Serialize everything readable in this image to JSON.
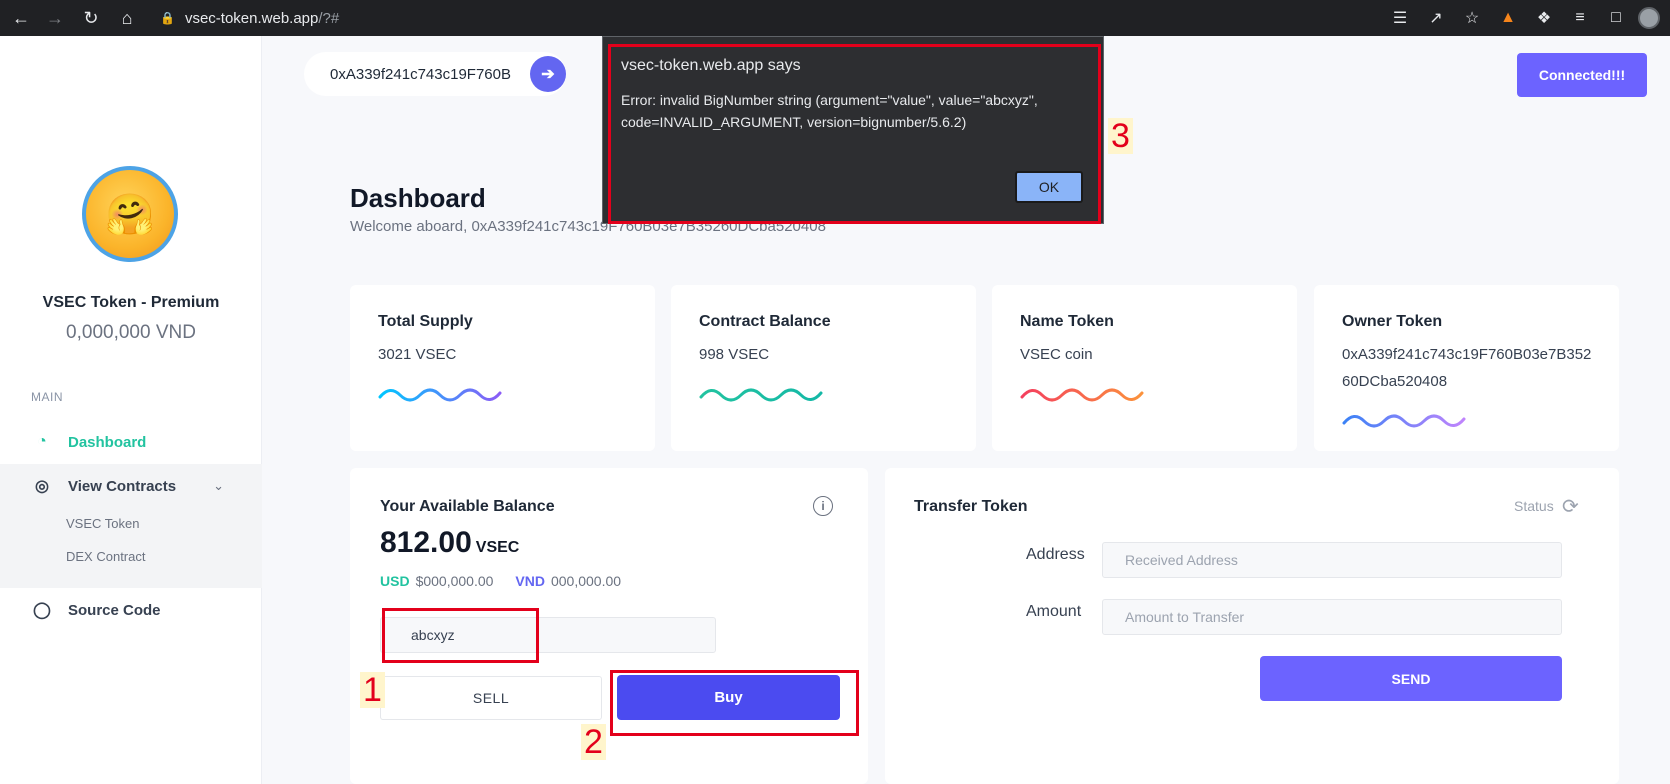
{
  "browser": {
    "url_host": "vsec-token.web.app",
    "url_path": "/?#"
  },
  "sidebar": {
    "name": "VSEC Token - Premium",
    "balance": "0,000,000 VND",
    "section": "MAIN",
    "items": [
      {
        "label": "Dashboard"
      },
      {
        "label": "View Contracts"
      },
      {
        "label": "Source Code"
      }
    ],
    "subitems": [
      {
        "label": "VSEC Token"
      },
      {
        "label": "DEX Contract"
      }
    ]
  },
  "header": {
    "address_value": "0xA339f241c743c19F760B",
    "connect_label": "Connected!!!"
  },
  "dashboard": {
    "title": "Dashboard",
    "welcome": "Welcome aboard, 0xA339f241c743c19F760B03e7B35260DCba520408"
  },
  "stats": [
    {
      "label": "Total Supply",
      "value": "3021 VSEC",
      "color1": "#00c6ff",
      "color2": "#8b5cf6"
    },
    {
      "label": "Contract Balance",
      "value": "998 VSEC",
      "color1": "#22c3a0",
      "color2": "#14b8a6"
    },
    {
      "label": "Name Token",
      "value": "VSEC coin",
      "color1": "#f43f5e",
      "color2": "#fb923c"
    },
    {
      "label": "Owner Token",
      "value": "0xA339f241c743c19F760B03e7B35260DCba520408",
      "color1": "#3b82f6",
      "color2": "#c084fc"
    }
  ],
  "balance_panel": {
    "title": "Your Available Balance",
    "amount": "812.00",
    "unit": "VSEC",
    "usd_label": "USD",
    "usd_value": "$000,000.00",
    "vnd_label": "VND",
    "vnd_value": "000,000.00",
    "input_value": "abcxyz",
    "sell_label": "SELL",
    "buy_label": "Buy"
  },
  "transfer_panel": {
    "title": "Transfer Token",
    "status_label": "Status",
    "address_label": "Address",
    "address_placeholder": "Received Address",
    "amount_label": "Amount",
    "amount_placeholder": "Amount to Transfer",
    "send_label": "SEND"
  },
  "dialog": {
    "title": "vsec-token.web.app says",
    "message": "Error: invalid BigNumber string (argument=\"value\", value=\"abcxyz\", code=INVALID_ARGUMENT, version=bignumber/5.6.2)",
    "ok_label": "OK"
  },
  "annotations": {
    "n1": "1",
    "n2": "2",
    "n3": "3"
  }
}
